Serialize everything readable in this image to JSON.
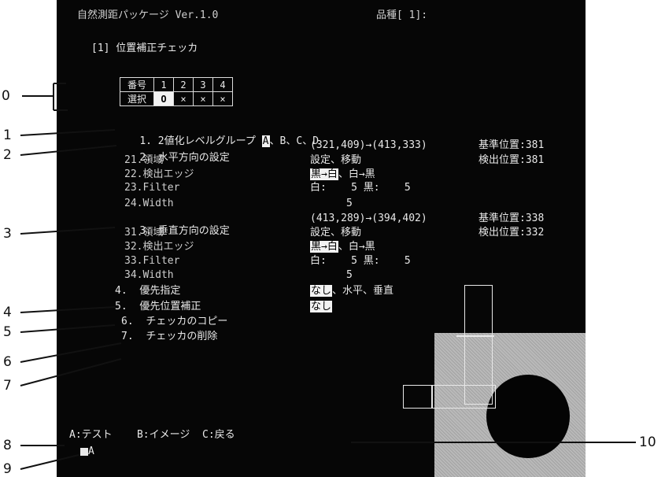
{
  "header": {
    "title": "自然測距パッケージ Ver.1.0",
    "product": "品種[ 1]:",
    "checker_title": "[1] 位置補正チェッカ"
  },
  "selection_table": {
    "row1_label": "番号",
    "numbers": [
      "1",
      "2",
      "3",
      "4"
    ],
    "row2_label": "選択",
    "choices": [
      "O",
      "×",
      "×",
      "×"
    ]
  },
  "menu": [
    {
      "no": "1.",
      "label": "2値化レベルグループ",
      "value": "",
      "options": [
        "A",
        "B",
        "C",
        "D"
      ],
      "selected": "A"
    },
    {
      "no": "2.",
      "label": "水平方向の設定",
      "coords": "(321,409)→(413,333)",
      "ref_label": "基準位置:",
      "ref_val": "381",
      "det_label": "検出位置:",
      "det_val": "381"
    },
    {
      "no": "21.",
      "label": "領域",
      "value": "設定、移動"
    },
    {
      "no": "22.",
      "label": "検出エッジ",
      "value_sel": "黒→白",
      "value_rest": "、白→黒"
    },
    {
      "no": "23.",
      "label": "Filter",
      "value": "白:    5 黒:    5"
    },
    {
      "no": "24.",
      "label": "Width",
      "value": "5"
    },
    {
      "no": "3.",
      "label": "垂直方向の設定",
      "coords": "(413,289)→(394,402)",
      "ref_label": "基準位置:",
      "ref_val": "338",
      "det_label": "検出位置:",
      "det_val": "332"
    },
    {
      "no": "31.",
      "label": "領域",
      "value": "設定、移動"
    },
    {
      "no": "32.",
      "label": "検出エッジ",
      "value_sel": "黒→白",
      "value_rest": "、白→黒"
    },
    {
      "no": "33.",
      "label": "Filter",
      "value": "白:    5 黒:    5"
    },
    {
      "no": "34.",
      "label": "Width",
      "value": "5"
    },
    {
      "no": "4.",
      "label": "優先指定",
      "value_sel": "なし",
      "value_rest": "、水平、垂直"
    },
    {
      "no": "5.",
      "label": "優先位置補正",
      "value_sel": "なし",
      "value_rest": ""
    },
    {
      "no": "6.",
      "label": "チェッカのコピー"
    },
    {
      "no": "7.",
      "label": "チェッカの削除"
    }
  ],
  "footer": {
    "keys": "A:テスト    B:イメージ  C:戻る",
    "mode": "A"
  },
  "callouts": [
    "0",
    "1",
    "2",
    "3",
    "4",
    "5",
    "6",
    "7",
    "8",
    "9",
    "10"
  ]
}
